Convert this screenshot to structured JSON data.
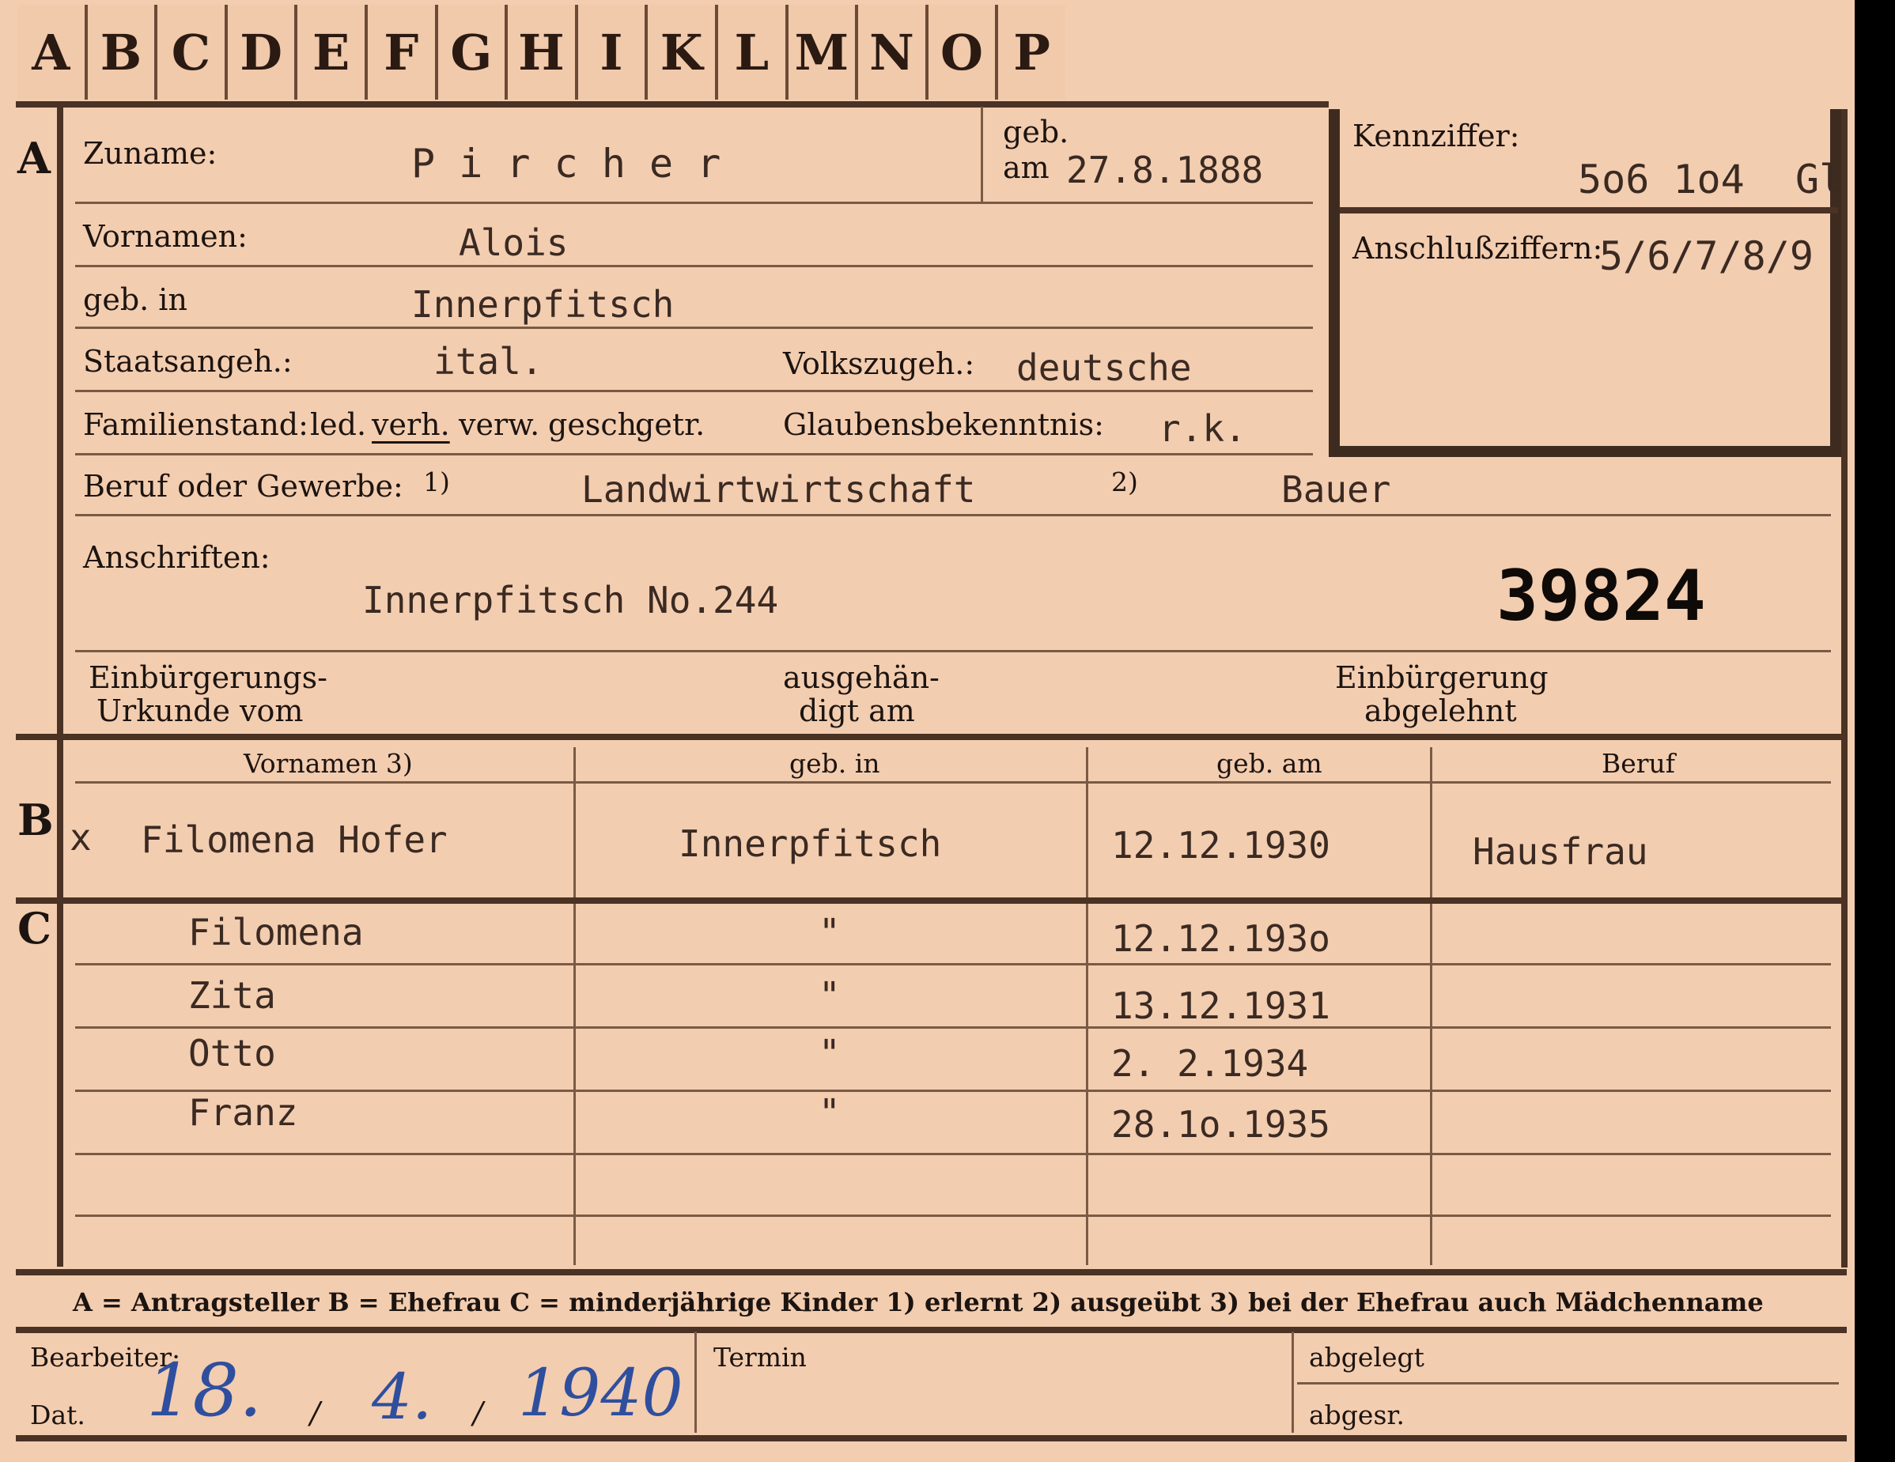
{
  "alphabet": [
    "A",
    "B",
    "C",
    "D",
    "E",
    "F",
    "G",
    "H",
    "I",
    "K",
    "L",
    "M",
    "N",
    "O",
    "P"
  ],
  "section_marks": {
    "a": "A",
    "b": "B",
    "c": "C"
  },
  "applicant": {
    "surname_label": "Zuname:",
    "surname": "P i r c h e r",
    "born_label_1": "geb.",
    "born_label_2": "am",
    "birth_date": "27.8.1888",
    "first_names_label": "Vornamen:",
    "first_names": "Alois",
    "birthplace_label": "geb. in",
    "birthplace": "Innerpfitsch",
    "citizenship_label": "Staatsangeh.:",
    "citizenship": "ital.",
    "ethnicity_label": "Volkszugeh.:",
    "ethnicity": "deutsche",
    "marital_label": "Familienstand:",
    "marital_options": [
      "led.",
      "verh.",
      "verw.",
      "gesch.",
      "getr."
    ],
    "marital_selected": "verh.",
    "religion_label": "Glaubensbekenntnis:",
    "religion": "r.k.",
    "occupation_label": "Beruf oder Gewerbe:",
    "footnote_1": "1)",
    "footnote_2": "2)",
    "occupation_learned": "Landwirtwirtschaft",
    "occupation_practiced": "Bauer",
    "address_label": "Anschriften:",
    "address": "Innerpfitsch No.244",
    "stamp_number": "39824",
    "naturalization_label_1": "Einbürgerungs-",
    "naturalization_label_2": "Urkunde vom",
    "handed_label_1": "ausgehän-",
    "handed_label_2": "digt am",
    "rejected_label_1": "Einbürgerung",
    "rejected_label_2": "abgelehnt"
  },
  "identification": {
    "code_label": "Kennziffer:",
    "code": "5o6 1o4",
    "code_suffix": "Gl",
    "link_label": "Anschlußziffern:",
    "link_numbers": "5/6/7/8/9"
  },
  "wife_table": {
    "headers": [
      "Vornamen 3)",
      "geb. in",
      "geb. am",
      "Beruf"
    ],
    "row": {
      "mark": "x",
      "name": "Filomena Hofer",
      "birthplace": "Innerpfitsch",
      "birth_date": "12.12.1930",
      "occupation": "Hausfrau"
    }
  },
  "children": [
    {
      "name": "Filomena",
      "birthplace": "\"",
      "birth_date": "12.12.193o"
    },
    {
      "name": "Zita",
      "birthplace": "\"",
      "birth_date": "13.12.1931"
    },
    {
      "name": "Otto",
      "birthplace": "\"",
      "birth_date": "2. 2.1934"
    },
    {
      "name": "Franz",
      "birthplace": "\"",
      "birth_date": "28.1o.1935"
    }
  ],
  "legend": "A = Antragsteller   B = Ehefrau   C = minderjährige Kinder   1) erlernt   2) ausgeübt   3) bei der Ehefrau auch Mädchenname",
  "footer": {
    "processor_label": "Bearbeiter:",
    "date_label": "Dat.",
    "date_day": "18.",
    "date_sep1": "/",
    "date_month": "4.",
    "date_sep2": "/",
    "date_year": "1940",
    "term_label": "Termin",
    "filed_label": "abgelegt",
    "sent_label": "abgesr."
  }
}
